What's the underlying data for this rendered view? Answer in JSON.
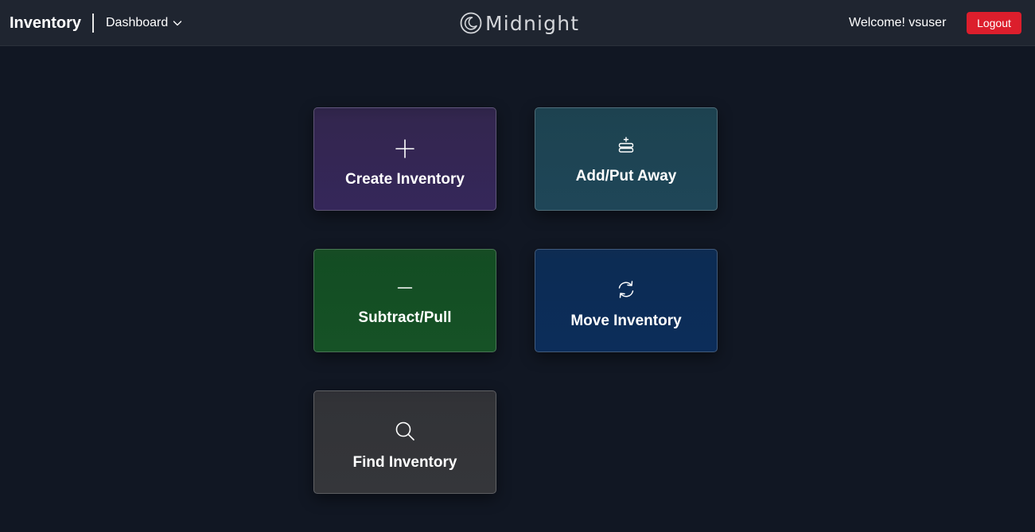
{
  "header": {
    "app_title": "Inventory",
    "nav_dropdown_label": "Dashboard",
    "logo_text": "Midnight",
    "welcome_text": "Welcome! vsuser",
    "logout_label": "Logout"
  },
  "tiles": [
    {
      "label": "Create Inventory",
      "icon": "plus-icon",
      "color": "#33264f"
    },
    {
      "label": "Add/Put Away",
      "icon": "stack-add-icon",
      "color": "#1d4351"
    },
    {
      "label": "Subtract/Pull",
      "icon": "minus-icon",
      "color": "#134d23"
    },
    {
      "label": "Move Inventory",
      "icon": "refresh-arrows-icon",
      "color": "#0c2c54"
    },
    {
      "label": "Find Inventory",
      "icon": "search-icon",
      "color": "#323337"
    }
  ],
  "colors": {
    "page_background": "#111723",
    "header_background": "#1f2530",
    "logout_button": "#dc1e2c"
  }
}
